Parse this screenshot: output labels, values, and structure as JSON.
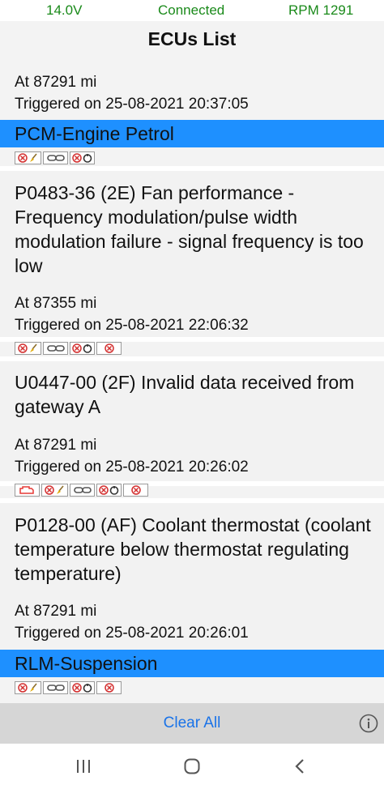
{
  "status": {
    "voltage": "14.0V",
    "connection": "Connected",
    "rpm": "RPM 1291"
  },
  "title": "ECUs List",
  "entries": [
    {
      "mileage": "At 87291 mi",
      "triggered": "Triggered on 25-08-2021 20:37:05"
    },
    {
      "ecu": "PCM-Engine Petrol"
    },
    {
      "code": "P0483-36 (2E) Fan performance - Frequency modulation/pulse width modulation failure - signal frequency is too low",
      "mileage": "At 87355 mi",
      "triggered": "Triggered on 25-08-2021 22:06:32"
    },
    {
      "code": "U0447-00 (2F) Invalid data received from gateway  A",
      "mileage": "At 87291 mi",
      "triggered": "Triggered on 25-08-2021 20:26:02"
    },
    {
      "code": "P0128-00 (AF) Coolant thermostat (coolant temperature below thermostat regulating temperature)",
      "mileage": "At 87291 mi",
      "triggered": "Triggered on 25-08-2021 20:26:01"
    },
    {
      "ecu": "RLM-Suspension"
    }
  ],
  "footer": {
    "clear_all": "Clear All"
  },
  "icons": [
    "clear-dtc-icon",
    "link-icon",
    "freeze-frame-icon",
    "cancel-icon",
    "engine-warning-icon",
    "info-icon"
  ],
  "colors": {
    "accent": "#1e90ff",
    "status_text": "#1a8a1a",
    "button_text": "#1a73e8",
    "error": "#d32f2f"
  }
}
